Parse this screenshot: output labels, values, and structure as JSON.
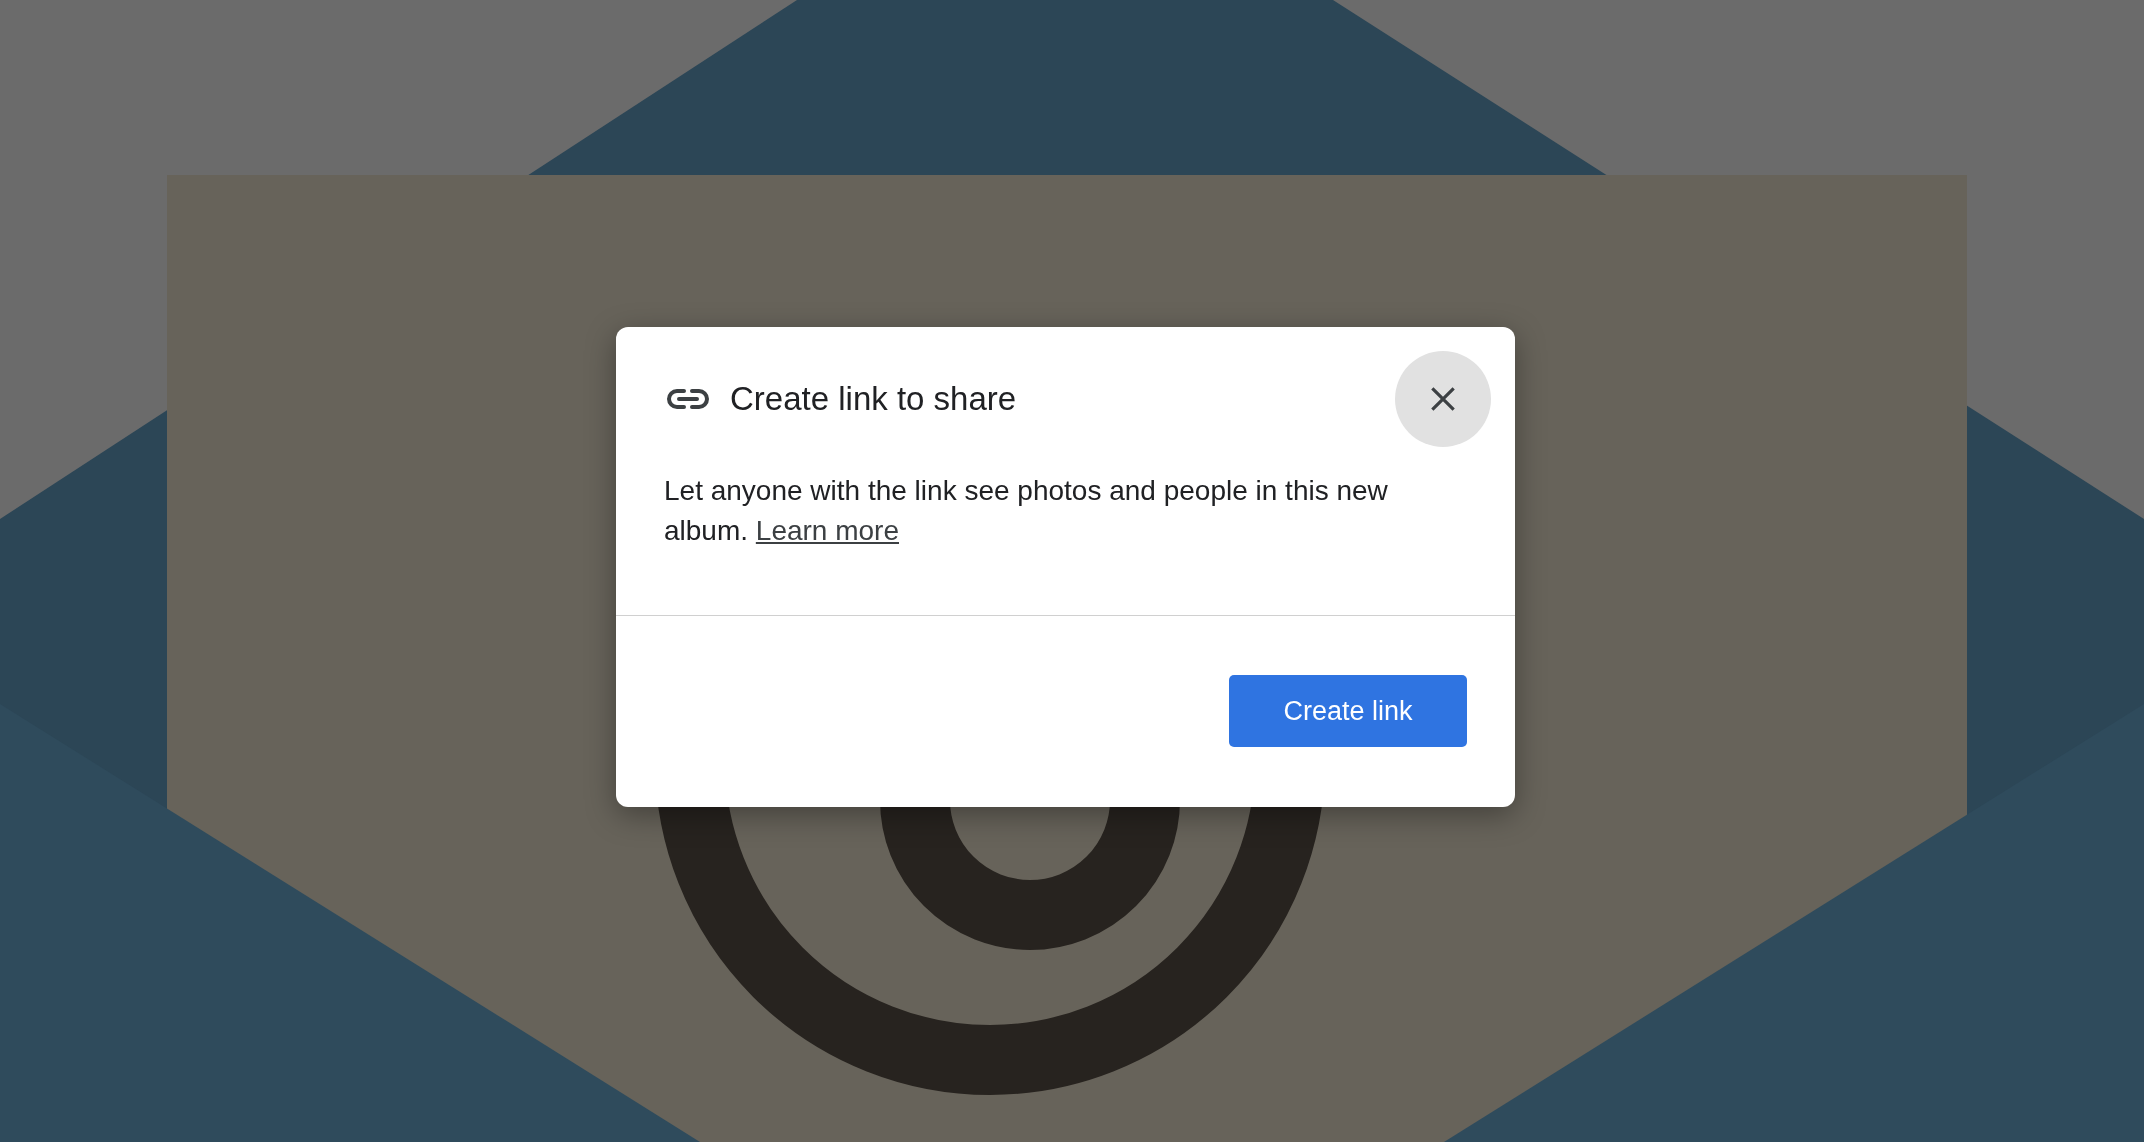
{
  "dialog": {
    "title": "Create link to share",
    "description": {
      "text": "Let anyone with the link see photos and people in this new album.",
      "link": "Learn more"
    },
    "primary_button": "Create link"
  }
}
